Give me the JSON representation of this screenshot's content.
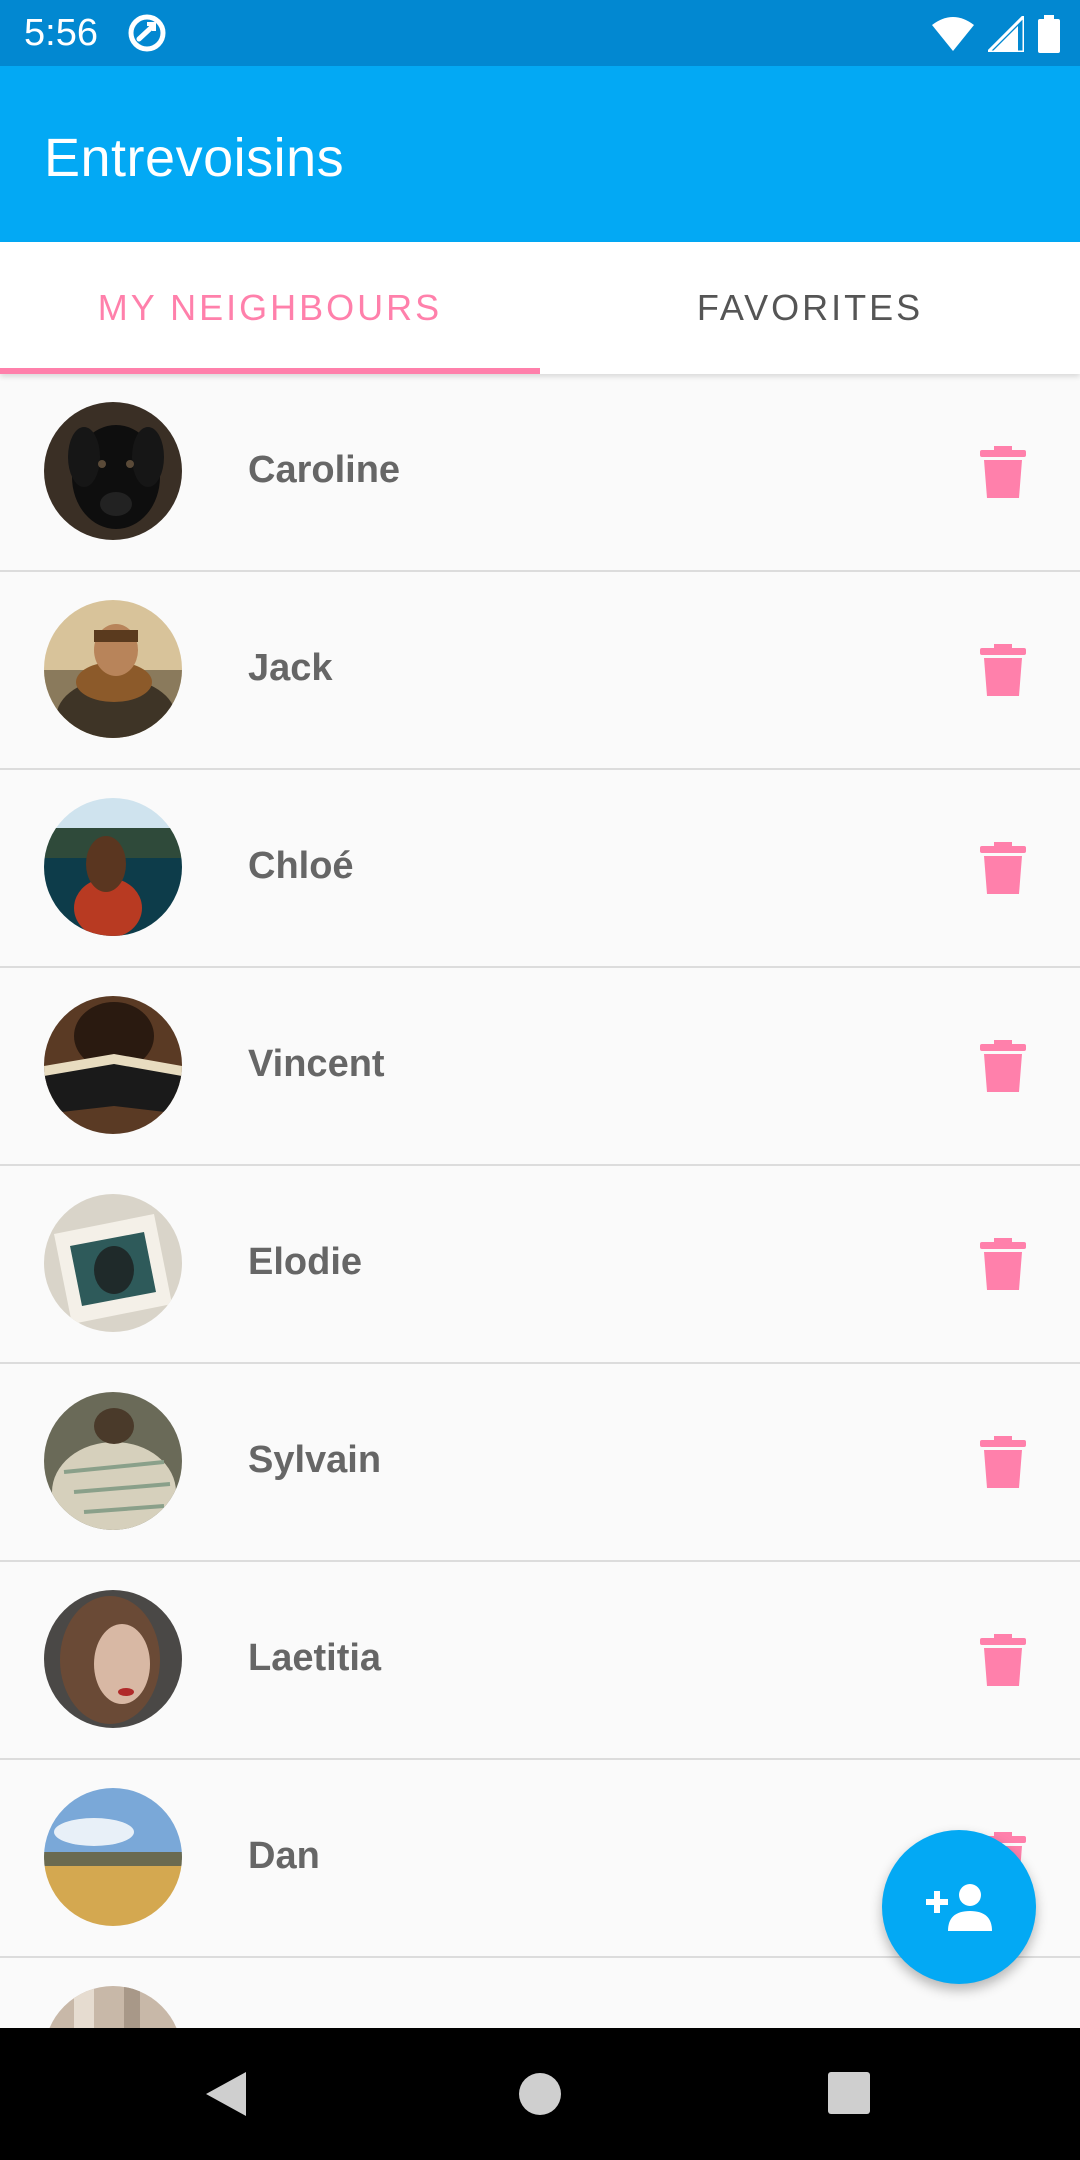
{
  "status_bar": {
    "time": "5:56",
    "app_icon": "sync-icon",
    "icons": [
      "wifi-icon",
      "signal-icon",
      "battery-icon"
    ]
  },
  "app_bar": {
    "title": "Entrevoisins"
  },
  "tabs": [
    {
      "label": "MY NEIGHBOURS",
      "selected": true
    },
    {
      "label": "FAVORITES",
      "selected": false
    }
  ],
  "neighbours": [
    {
      "name": "Caroline",
      "avatar": "black-dog-photo"
    },
    {
      "name": "Jack",
      "avatar": "man-scarf-photo"
    },
    {
      "name": "Chloé",
      "avatar": "woman-lake-photo"
    },
    {
      "name": "Vincent",
      "avatar": "reading-bible-photo"
    },
    {
      "name": "Elodie",
      "avatar": "photo-print-photo"
    },
    {
      "name": "Sylvain",
      "avatar": "pug-blanket-photo"
    },
    {
      "name": "Laetitia",
      "avatar": "woman-portrait-photo"
    },
    {
      "name": "Dan",
      "avatar": "field-landscape-photo"
    },
    {
      "name": "",
      "avatar": "partial-photo"
    }
  ],
  "fab": {
    "icon": "add-person-icon"
  },
  "nav": [
    "back-icon",
    "home-icon",
    "recents-icon"
  ],
  "colors": {
    "status_bar": "#0288d1",
    "primary": "#03a9f4",
    "accent": "#ff80ab",
    "name_text": "#666666",
    "tab_text": "#555555"
  }
}
